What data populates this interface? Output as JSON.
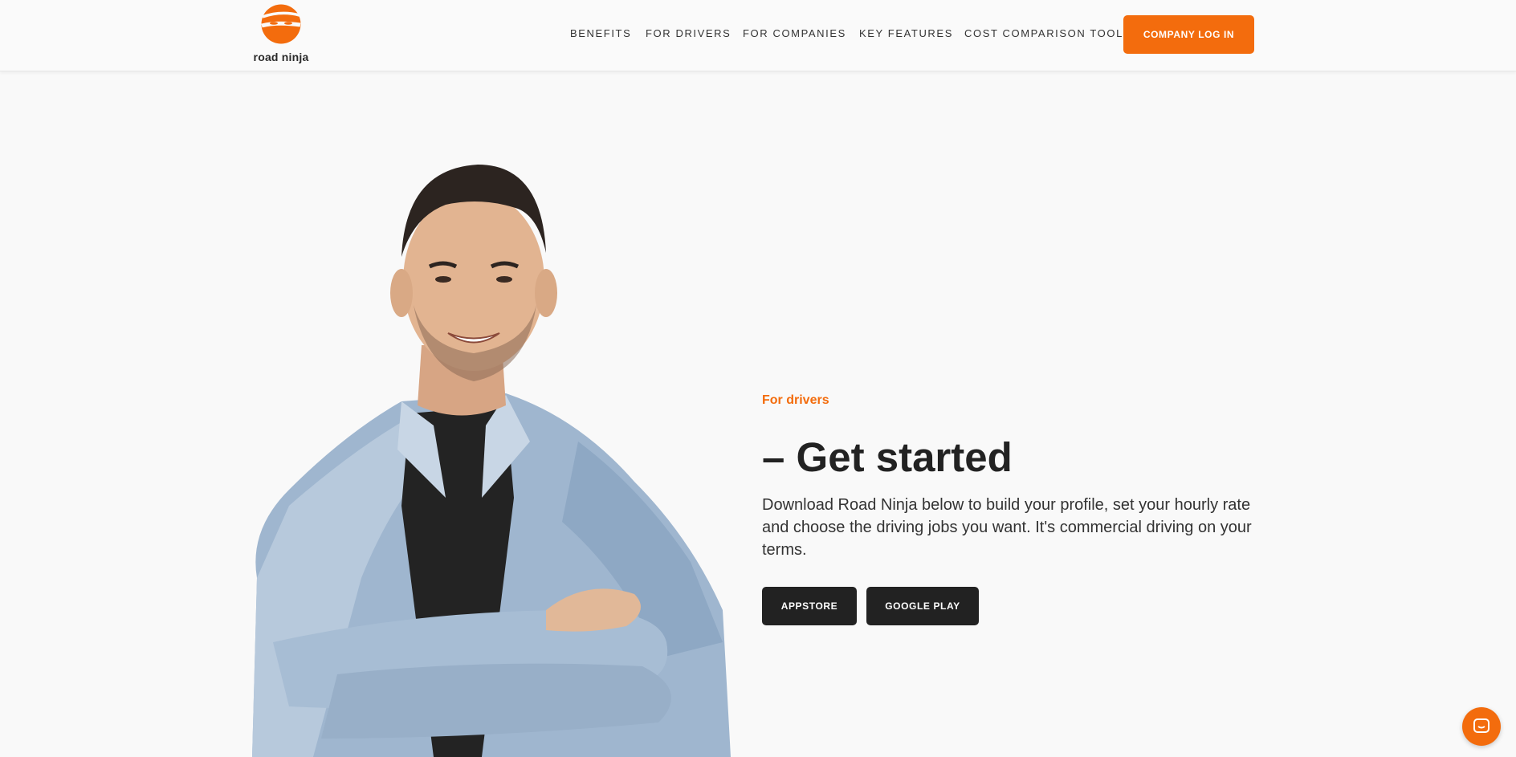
{
  "brand": {
    "name": "road ninja",
    "accent_color": "#f36c0d",
    "logo_icon": "orange-ninja-ball-icon"
  },
  "nav": {
    "items": [
      {
        "label": "BENEFITS"
      },
      {
        "label": "FOR DRIVERS"
      },
      {
        "label": "FOR COMPANIES"
      },
      {
        "label": "KEY FEATURES"
      },
      {
        "label": "COST COMPARISON TOOL"
      }
    ],
    "cta_label": "COMPANY LOG IN"
  },
  "hero": {
    "eyebrow": "For drivers",
    "headline": "– Get started",
    "body": "Download Road Ninja below to build your profile, set your hourly rate and choose the driving jobs you want. It's commercial driving on your terms.",
    "buttons": [
      {
        "label": "APPSTORE"
      },
      {
        "label": "GOOGLE PLAY"
      }
    ],
    "image": "smiling-man-denim-shirt-arms-crossed"
  },
  "chat": {
    "icon": "chat-icon"
  }
}
